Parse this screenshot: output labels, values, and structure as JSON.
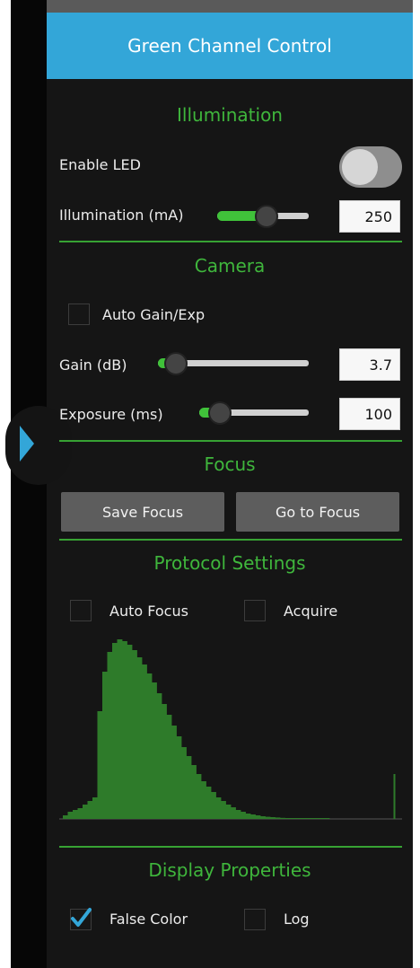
{
  "panel": {
    "title": "Green Channel Control"
  },
  "illumination": {
    "title": "Illumination",
    "enable_led_label": "Enable LED",
    "enable_led_on": false,
    "current_label": "Illumination (mA)",
    "current_value": "250",
    "current_level": 0.55
  },
  "camera": {
    "title": "Camera",
    "auto_label": "Auto Gain/Exp",
    "auto_checked": false,
    "gain_label": "Gain (dB)",
    "gain_value": "3.7",
    "gain_level": 0.05,
    "exposure_label": "Exposure (ms)",
    "exposure_value": "100",
    "exposure_level": 0.1
  },
  "focus": {
    "title": "Focus",
    "save_label": "Save Focus",
    "goto_label": "Go to Focus"
  },
  "protocol": {
    "title": "Protocol Settings",
    "autofocus_label": "Auto Focus",
    "autofocus_checked": false,
    "acquire_label": "Acquire",
    "acquire_checked": false
  },
  "histogram": {
    "color": "#2e7b2a",
    "bins": [
      0.02,
      0.04,
      0.05,
      0.06,
      0.08,
      0.1,
      0.12,
      0.6,
      0.82,
      0.93,
      0.98,
      1.0,
      0.99,
      0.97,
      0.94,
      0.9,
      0.86,
      0.81,
      0.76,
      0.7,
      0.64,
      0.58,
      0.52,
      0.46,
      0.4,
      0.35,
      0.3,
      0.25,
      0.21,
      0.18,
      0.15,
      0.12,
      0.1,
      0.08,
      0.065,
      0.05,
      0.04,
      0.03,
      0.025,
      0.02,
      0.015,
      0.012,
      0.01,
      0.008,
      0.006,
      0.005,
      0.004,
      0.003,
      0.002,
      0.002,
      0.001,
      0.001,
      0.001,
      0.001,
      0,
      0,
      0,
      0,
      0,
      0,
      0,
      0,
      0,
      0,
      0,
      0,
      0,
      0.25
    ]
  },
  "display": {
    "title": "Display Properties",
    "false_color_label": "False Color",
    "false_color_checked": true,
    "log_label": "Log",
    "log_checked": false
  },
  "colors": {
    "accent_blue": "#33a6d8",
    "accent_green": "#3fb63c"
  }
}
